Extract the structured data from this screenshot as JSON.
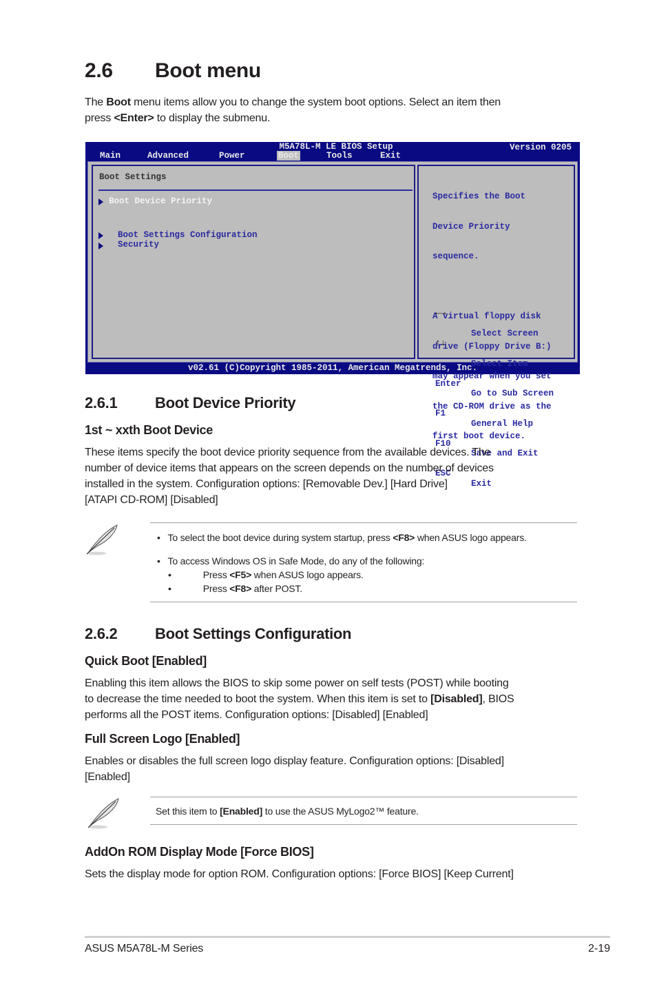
{
  "page": {
    "section_number": "2.6",
    "section_title": "Boot menu",
    "intro": {
      "part1": "The ",
      "bold1": "Boot",
      "part2": " menu items allow you to change the system boot options. Select an item then",
      "part3": "press ",
      "bold2": "<Enter>",
      "part4": " to display the submenu."
    }
  },
  "bios": {
    "title": "M5A78L-M LE BIOS Setup",
    "version": "Version 0205",
    "menu": [
      "Main",
      "Advanced",
      "Power",
      "Boot",
      "Tools",
      "Exit"
    ],
    "active_menu": "Boot",
    "panel_heading": "Boot Settings",
    "items": [
      {
        "label": "Boot Device Priority",
        "selected": true
      },
      {
        "label": "Boot Settings Configuration",
        "selected": false
      },
      {
        "label": "Security",
        "selected": false
      }
    ],
    "help_lines": [
      "Specifies the Boot",
      "Device Priority",
      "sequence.",
      "",
      "A virtual floppy disk",
      "drive (Floppy Drive B:)",
      "may appear when you set",
      "the CD-ROM drive as the",
      "first boot device."
    ],
    "keys": [
      {
        "key": "left-right-arrows",
        "desc": "Select Screen"
      },
      {
        "key": "up-down-arrows",
        "desc": "Select Item"
      },
      {
        "key": "Enter",
        "desc": "Go to Sub Screen"
      },
      {
        "key": "F1",
        "desc": "General Help"
      },
      {
        "key": "F10",
        "desc": "Save and Exit"
      },
      {
        "key": "ESC",
        "desc": "Exit"
      }
    ],
    "footer": "v02.61 (C)Copyright 1985-2011, American Megatrends, Inc."
  },
  "s261": {
    "number": "2.6.1",
    "title": "Boot Device Priority",
    "subheading": "1st ~ xxth Boot Device",
    "lines": [
      "These items specify the boot device priority sequence from the available devices. The",
      "number of device items that appears on the screen depends on the number of devices",
      "installed in the system. Configuration options: [Removable Dev.] [Hard Drive]",
      "[ATAPI CD-ROM] [Disabled]"
    ],
    "note": {
      "b1_pre": "To select the boot device during system startup, press ",
      "b1_bold": "<F8>",
      "b1_post": " when ASUS logo appears.",
      "b2": "To access Windows OS in Safe Mode, do any of the following:",
      "s1_pre": "Press ",
      "s1_bold": "<F5>",
      "s1_post": " when ASUS logo appears.",
      "s2_pre": "Press ",
      "s2_bold": "<F8>",
      "s2_post": " after POST."
    }
  },
  "s262": {
    "number": "2.6.2",
    "title": "Boot Settings Configuration",
    "quick_boot": {
      "heading": "Quick Boot [Enabled]",
      "l1": "Enabling this item allows the BIOS to skip some power on self tests (POST) while booting",
      "l2_pre": "to decrease the time needed to boot the system. When this item is set to ",
      "l2_bold": "[Disabled]",
      "l2_post": ", BIOS",
      "l3": "performs all the POST items. Configuration options: [Disabled] [Enabled]"
    },
    "full_screen_logo": {
      "heading": "Full Screen Logo [Enabled]",
      "l1": "Enables or disables the full screen logo display feature. Configuration options: [Disabled]",
      "l2": "[Enabled]"
    },
    "note": {
      "pre": "Set this item to ",
      "bold": "[Enabled]",
      "post": " to use the ASUS MyLogo2™ feature."
    },
    "addon_rom": {
      "heading": "AddOn ROM Display Mode [Force BIOS]",
      "l1": "Sets the display mode for option ROM. Configuration options: [Force BIOS] [Keep Current]"
    }
  },
  "footer": {
    "left": "ASUS M5A78L-M Series",
    "right": "2-19"
  }
}
